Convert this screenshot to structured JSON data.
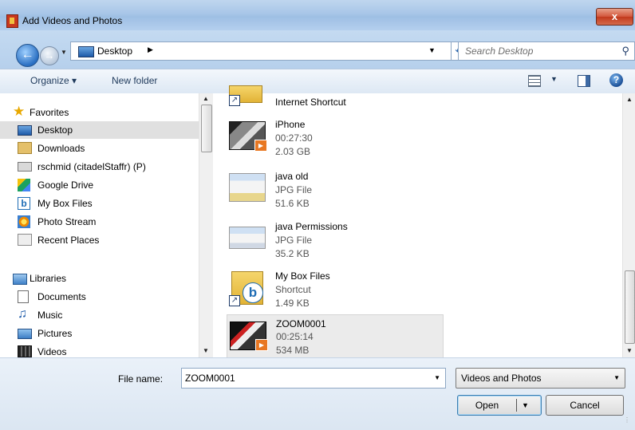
{
  "window": {
    "title": "Add Videos and Photos",
    "close_label": "x"
  },
  "address": {
    "location": "Desktop",
    "search_placeholder": "Search Desktop"
  },
  "toolbar": {
    "organize": "Organize ▾",
    "new_folder": "New folder",
    "help": "?"
  },
  "nav": {
    "favorites": "Favorites",
    "desktop": "Desktop",
    "downloads": "Downloads",
    "network": "rschmid (citadelStaffr) (P)",
    "google_drive": "Google Drive",
    "box": "My Box Files",
    "photo_stream": "Photo Stream",
    "recent": "Recent Places",
    "libraries": "Libraries",
    "documents": "Documents",
    "music": "Music",
    "pictures": "Pictures",
    "videos": "Videos"
  },
  "files": [
    {
      "name": "Internet Shortcut",
      "kind": "",
      "size": ""
    },
    {
      "name": "iPhone",
      "kind": "00:27:30",
      "size": "2.03 GB"
    },
    {
      "name": "java old",
      "kind": "JPG File",
      "size": "51.6 KB"
    },
    {
      "name": "java Permissions",
      "kind": "JPG File",
      "size": "35.2 KB"
    },
    {
      "name": "My Box Files",
      "kind": "Shortcut",
      "size": "1.49 KB"
    },
    {
      "name": "ZOOM0001",
      "kind": "00:25:14",
      "size": "534 MB"
    }
  ],
  "bottom": {
    "file_name_label": "File name:",
    "file_name_value": "ZOOM0001",
    "file_type": "Videos and Photos",
    "open": "Open",
    "cancel": "Cancel"
  },
  "colors": {
    "titlebar": "#a8c6e8",
    "close": "#c2391c",
    "selection": "#e0e0e0",
    "link_blue": "#1e395b"
  }
}
